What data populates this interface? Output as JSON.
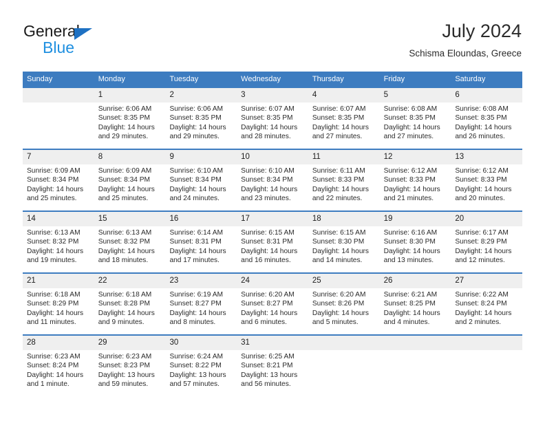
{
  "brand": {
    "name_part1": "General",
    "name_part2": "Blue",
    "accent_blue": "#1e8fe0",
    "triangle_blue": "#1e71c3"
  },
  "header": {
    "month_title": "July 2024",
    "location": "Schisma Eloundas, Greece"
  },
  "theme": {
    "header_row_blue": "#3d7cc0",
    "day_band_gray": "#efefef",
    "week_divider_blue": "#3d7cc0"
  },
  "calendar": {
    "weekday_headers": [
      "Sunday",
      "Monday",
      "Tuesday",
      "Wednesday",
      "Thursday",
      "Friday",
      "Saturday"
    ],
    "weeks": [
      [
        {
          "day": "",
          "sunrise": "",
          "sunset": "",
          "daylight1": "",
          "daylight2": ""
        },
        {
          "day": "1",
          "sunrise": "Sunrise: 6:06 AM",
          "sunset": "Sunset: 8:35 PM",
          "daylight1": "Daylight: 14 hours",
          "daylight2": "and 29 minutes."
        },
        {
          "day": "2",
          "sunrise": "Sunrise: 6:06 AM",
          "sunset": "Sunset: 8:35 PM",
          "daylight1": "Daylight: 14 hours",
          "daylight2": "and 29 minutes."
        },
        {
          "day": "3",
          "sunrise": "Sunrise: 6:07 AM",
          "sunset": "Sunset: 8:35 PM",
          "daylight1": "Daylight: 14 hours",
          "daylight2": "and 28 minutes."
        },
        {
          "day": "4",
          "sunrise": "Sunrise: 6:07 AM",
          "sunset": "Sunset: 8:35 PM",
          "daylight1": "Daylight: 14 hours",
          "daylight2": "and 27 minutes."
        },
        {
          "day": "5",
          "sunrise": "Sunrise: 6:08 AM",
          "sunset": "Sunset: 8:35 PM",
          "daylight1": "Daylight: 14 hours",
          "daylight2": "and 27 minutes."
        },
        {
          "day": "6",
          "sunrise": "Sunrise: 6:08 AM",
          "sunset": "Sunset: 8:35 PM",
          "daylight1": "Daylight: 14 hours",
          "daylight2": "and 26 minutes."
        }
      ],
      [
        {
          "day": "7",
          "sunrise": "Sunrise: 6:09 AM",
          "sunset": "Sunset: 8:34 PM",
          "daylight1": "Daylight: 14 hours",
          "daylight2": "and 25 minutes."
        },
        {
          "day": "8",
          "sunrise": "Sunrise: 6:09 AM",
          "sunset": "Sunset: 8:34 PM",
          "daylight1": "Daylight: 14 hours",
          "daylight2": "and 25 minutes."
        },
        {
          "day": "9",
          "sunrise": "Sunrise: 6:10 AM",
          "sunset": "Sunset: 8:34 PM",
          "daylight1": "Daylight: 14 hours",
          "daylight2": "and 24 minutes."
        },
        {
          "day": "10",
          "sunrise": "Sunrise: 6:10 AM",
          "sunset": "Sunset: 8:34 PM",
          "daylight1": "Daylight: 14 hours",
          "daylight2": "and 23 minutes."
        },
        {
          "day": "11",
          "sunrise": "Sunrise: 6:11 AM",
          "sunset": "Sunset: 8:33 PM",
          "daylight1": "Daylight: 14 hours",
          "daylight2": "and 22 minutes."
        },
        {
          "day": "12",
          "sunrise": "Sunrise: 6:12 AM",
          "sunset": "Sunset: 8:33 PM",
          "daylight1": "Daylight: 14 hours",
          "daylight2": "and 21 minutes."
        },
        {
          "day": "13",
          "sunrise": "Sunrise: 6:12 AM",
          "sunset": "Sunset: 8:33 PM",
          "daylight1": "Daylight: 14 hours",
          "daylight2": "and 20 minutes."
        }
      ],
      [
        {
          "day": "14",
          "sunrise": "Sunrise: 6:13 AM",
          "sunset": "Sunset: 8:32 PM",
          "daylight1": "Daylight: 14 hours",
          "daylight2": "and 19 minutes."
        },
        {
          "day": "15",
          "sunrise": "Sunrise: 6:13 AM",
          "sunset": "Sunset: 8:32 PM",
          "daylight1": "Daylight: 14 hours",
          "daylight2": "and 18 minutes."
        },
        {
          "day": "16",
          "sunrise": "Sunrise: 6:14 AM",
          "sunset": "Sunset: 8:31 PM",
          "daylight1": "Daylight: 14 hours",
          "daylight2": "and 17 minutes."
        },
        {
          "day": "17",
          "sunrise": "Sunrise: 6:15 AM",
          "sunset": "Sunset: 8:31 PM",
          "daylight1": "Daylight: 14 hours",
          "daylight2": "and 16 minutes."
        },
        {
          "day": "18",
          "sunrise": "Sunrise: 6:15 AM",
          "sunset": "Sunset: 8:30 PM",
          "daylight1": "Daylight: 14 hours",
          "daylight2": "and 14 minutes."
        },
        {
          "day": "19",
          "sunrise": "Sunrise: 6:16 AM",
          "sunset": "Sunset: 8:30 PM",
          "daylight1": "Daylight: 14 hours",
          "daylight2": "and 13 minutes."
        },
        {
          "day": "20",
          "sunrise": "Sunrise: 6:17 AM",
          "sunset": "Sunset: 8:29 PM",
          "daylight1": "Daylight: 14 hours",
          "daylight2": "and 12 minutes."
        }
      ],
      [
        {
          "day": "21",
          "sunrise": "Sunrise: 6:18 AM",
          "sunset": "Sunset: 8:29 PM",
          "daylight1": "Daylight: 14 hours",
          "daylight2": "and 11 minutes."
        },
        {
          "day": "22",
          "sunrise": "Sunrise: 6:18 AM",
          "sunset": "Sunset: 8:28 PM",
          "daylight1": "Daylight: 14 hours",
          "daylight2": "and 9 minutes."
        },
        {
          "day": "23",
          "sunrise": "Sunrise: 6:19 AM",
          "sunset": "Sunset: 8:27 PM",
          "daylight1": "Daylight: 14 hours",
          "daylight2": "and 8 minutes."
        },
        {
          "day": "24",
          "sunrise": "Sunrise: 6:20 AM",
          "sunset": "Sunset: 8:27 PM",
          "daylight1": "Daylight: 14 hours",
          "daylight2": "and 6 minutes."
        },
        {
          "day": "25",
          "sunrise": "Sunrise: 6:20 AM",
          "sunset": "Sunset: 8:26 PM",
          "daylight1": "Daylight: 14 hours",
          "daylight2": "and 5 minutes."
        },
        {
          "day": "26",
          "sunrise": "Sunrise: 6:21 AM",
          "sunset": "Sunset: 8:25 PM",
          "daylight1": "Daylight: 14 hours",
          "daylight2": "and 4 minutes."
        },
        {
          "day": "27",
          "sunrise": "Sunrise: 6:22 AM",
          "sunset": "Sunset: 8:24 PM",
          "daylight1": "Daylight: 14 hours",
          "daylight2": "and 2 minutes."
        }
      ],
      [
        {
          "day": "28",
          "sunrise": "Sunrise: 6:23 AM",
          "sunset": "Sunset: 8:24 PM",
          "daylight1": "Daylight: 14 hours",
          "daylight2": "and 1 minute."
        },
        {
          "day": "29",
          "sunrise": "Sunrise: 6:23 AM",
          "sunset": "Sunset: 8:23 PM",
          "daylight1": "Daylight: 13 hours",
          "daylight2": "and 59 minutes."
        },
        {
          "day": "30",
          "sunrise": "Sunrise: 6:24 AM",
          "sunset": "Sunset: 8:22 PM",
          "daylight1": "Daylight: 13 hours",
          "daylight2": "and 57 minutes."
        },
        {
          "day": "31",
          "sunrise": "Sunrise: 6:25 AM",
          "sunset": "Sunset: 8:21 PM",
          "daylight1": "Daylight: 13 hours",
          "daylight2": "and 56 minutes."
        },
        {
          "day": "",
          "sunrise": "",
          "sunset": "",
          "daylight1": "",
          "daylight2": ""
        },
        {
          "day": "",
          "sunrise": "",
          "sunset": "",
          "daylight1": "",
          "daylight2": ""
        },
        {
          "day": "",
          "sunrise": "",
          "sunset": "",
          "daylight1": "",
          "daylight2": ""
        }
      ]
    ]
  }
}
